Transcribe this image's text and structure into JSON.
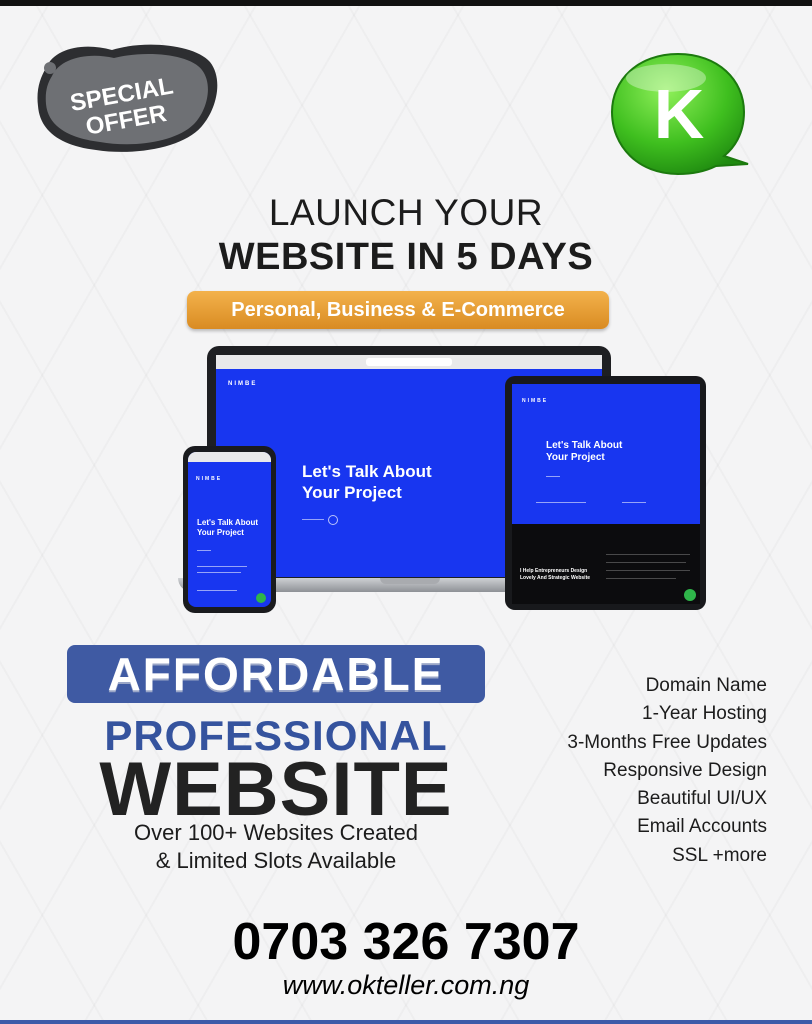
{
  "badge": {
    "line1": "SPECIAL",
    "line2": "OFFER"
  },
  "logo": {
    "letter": "K",
    "color": "#4cc72a"
  },
  "headline": {
    "line1": "LAUNCH YOUR",
    "line2": "WEBSITE IN 5 DAYS"
  },
  "pill": {
    "label": "Personal, Business & E-Commerce",
    "color": "#e39a2d"
  },
  "devices": {
    "brand": "NIMBE",
    "heading_line1": "Let's Talk About",
    "heading_line2": "Your Project",
    "tablet_dark_text_line1": "I Help Entrepreneurs Design",
    "tablet_dark_text_line2": "Lovely And Strategic Website",
    "screen_color": "#1836f0"
  },
  "promo": {
    "affordable": "AFFORDABLE",
    "professional": "PROFESSIONAL",
    "website": "WEBSITE",
    "sub_line1": "Over 100+ Websites Created",
    "sub_line2": "& Limited Slots Available",
    "accent_color": "#3f5aa3"
  },
  "features": [
    "Domain Name",
    "1-Year Hosting",
    "3-Months Free Updates",
    "Responsive Design",
    "Beautiful UI/UX",
    "Email Accounts",
    "SSL +more"
  ],
  "contact": {
    "phone": "0703 326 7307",
    "url": "www.okteller.com.ng"
  }
}
